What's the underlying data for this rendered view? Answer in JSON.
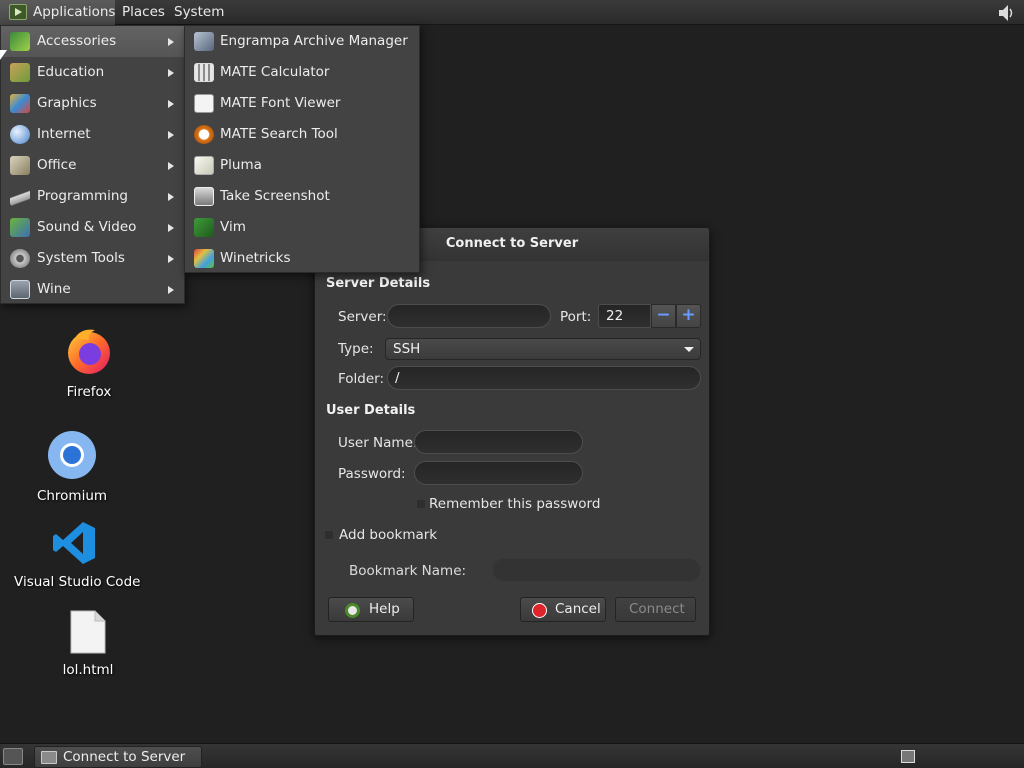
{
  "top_panel": {
    "menus": {
      "applications": "Applications",
      "places": "Places",
      "system": "System"
    }
  },
  "categories": [
    {
      "label": "Accessories",
      "icon": "accessories-icon",
      "active": true
    },
    {
      "label": "Education",
      "icon": "education-icon"
    },
    {
      "label": "Graphics",
      "icon": "graphics-icon"
    },
    {
      "label": "Internet",
      "icon": "internet-icon"
    },
    {
      "label": "Office",
      "icon": "office-icon"
    },
    {
      "label": "Programming",
      "icon": "programming-icon"
    },
    {
      "label": "Sound & Video",
      "icon": "sound-video-icon"
    },
    {
      "label": "System Tools",
      "icon": "system-tools-icon"
    },
    {
      "label": "Wine",
      "icon": "wine-icon"
    }
  ],
  "accessories": [
    {
      "label": "Engrampa Archive Manager",
      "icon": "archive-manager-icon"
    },
    {
      "label": "MATE Calculator",
      "icon": "calculator-icon"
    },
    {
      "label": "MATE Font Viewer",
      "icon": "font-viewer-icon"
    },
    {
      "label": "MATE Search Tool",
      "icon": "search-tool-icon"
    },
    {
      "label": "Pluma",
      "icon": "text-editor-icon"
    },
    {
      "label": "Take Screenshot",
      "icon": "screenshot-icon"
    },
    {
      "label": "Vim",
      "icon": "vim-icon"
    },
    {
      "label": "Winetricks",
      "icon": "winetricks-icon"
    }
  ],
  "desktop": [
    {
      "label": "Firefox",
      "icon": "firefox-icon"
    },
    {
      "label": "Chromium",
      "icon": "chromium-icon"
    },
    {
      "label": "Visual Studio Code",
      "icon": "vscode-icon"
    },
    {
      "label": "lol.html",
      "icon": "file-icon"
    }
  ],
  "dialog": {
    "title": "Connect to Server",
    "server_details": "Server Details",
    "server_label": "Server:",
    "server_value": "",
    "port_label": "Port:",
    "port_value": "22",
    "type_label": "Type:",
    "type_value": "SSH",
    "folder_label": "Folder:",
    "folder_value": "/",
    "user_details": "User Details",
    "username_label": "User Name:",
    "username_value": "",
    "password_label": "Password:",
    "password_value": "",
    "remember_label": "Remember this password",
    "bookmark_label": "Add bookmark",
    "bookmark_name_label": "Bookmark Name:",
    "bookmark_name_value": "",
    "help_label": "Help",
    "cancel_label": "Cancel",
    "connect_label": "Connect"
  },
  "bottom_panel": {
    "task_label": "Connect to Server"
  },
  "colors": {
    "desktop_bg": "#202020",
    "menu_bg": "#434343",
    "dialog_bg": "#3a3a3a",
    "spin_accent": "#6a9cff",
    "cancel_red": "#e0242c"
  }
}
